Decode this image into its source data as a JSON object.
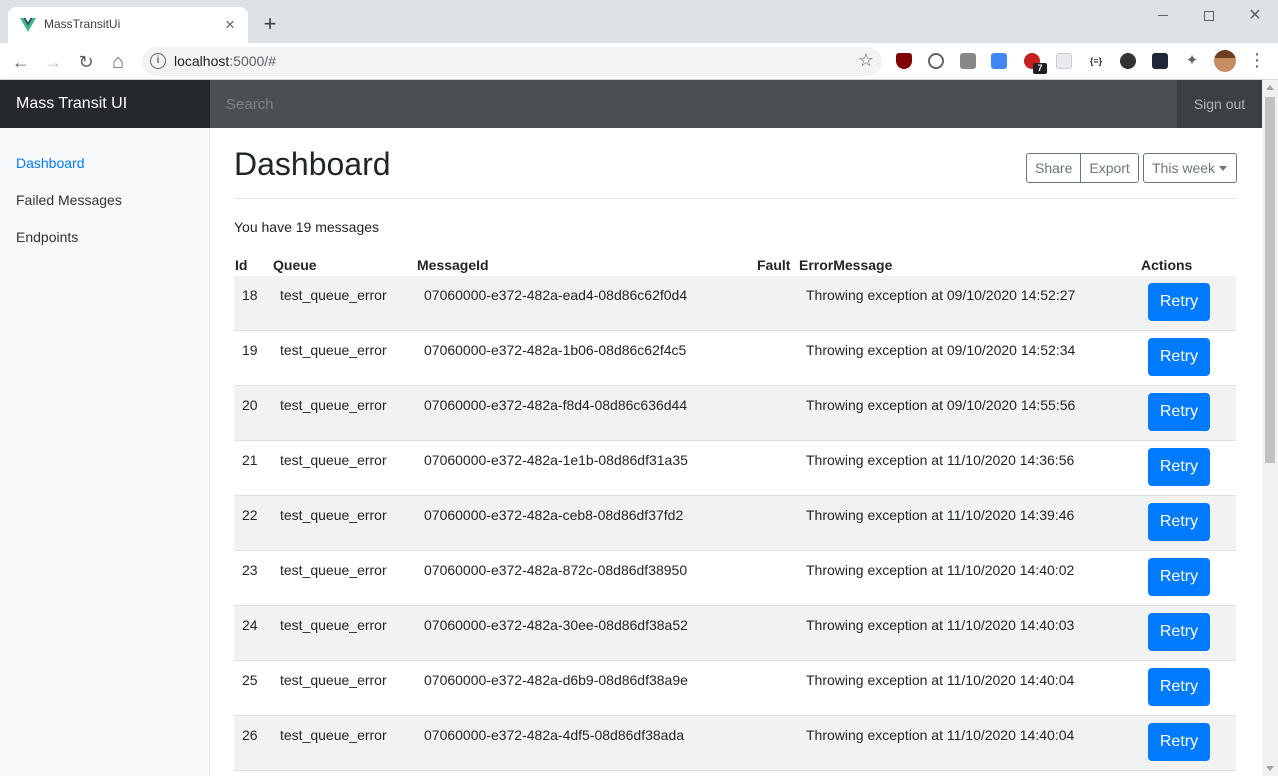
{
  "browser": {
    "tab_title": "MassTransitUi",
    "tab_close": "×",
    "new_tab": "+",
    "url_host": "localhost",
    "url_rest": ":5000/#",
    "info_symbol": "i",
    "star_symbol": "☆",
    "ext_badge": "7",
    "back": "←",
    "forward": "→",
    "reload": "↻",
    "home": "⌂",
    "menu": "⋮",
    "close_symbol": "✕"
  },
  "navbar": {
    "brand": "Mass Transit UI",
    "search_placeholder": "Search",
    "sign_out": "Sign out"
  },
  "sidebar": {
    "items": [
      {
        "label": "Dashboard",
        "active": true
      },
      {
        "label": "Failed Messages",
        "active": false
      },
      {
        "label": "Endpoints",
        "active": false
      }
    ]
  },
  "main": {
    "title": "Dashboard",
    "share": "Share",
    "export": "Export",
    "period": "This week",
    "message_count_text": "You have 19 messages"
  },
  "table": {
    "headers": [
      "Id",
      "Queue",
      "MessageId",
      "Fault",
      "ErrorMessage",
      "Actions"
    ],
    "retry_label": "Retry",
    "rows": [
      {
        "id": "18",
        "queue": "test_queue_error",
        "message_id": "07060000-e372-482a-ead4-08d86c62f0d4",
        "fault": "",
        "error": "Throwing exception at 09/10/2020 14:52:27"
      },
      {
        "id": "19",
        "queue": "test_queue_error",
        "message_id": "07060000-e372-482a-1b06-08d86c62f4c5",
        "fault": "",
        "error": "Throwing exception at 09/10/2020 14:52:34"
      },
      {
        "id": "20",
        "queue": "test_queue_error",
        "message_id": "07060000-e372-482a-f8d4-08d86c636d44",
        "fault": "",
        "error": "Throwing exception at 09/10/2020 14:55:56"
      },
      {
        "id": "21",
        "queue": "test_queue_error",
        "message_id": "07060000-e372-482a-1e1b-08d86df31a35",
        "fault": "",
        "error": "Throwing exception at 11/10/2020 14:36:56"
      },
      {
        "id": "22",
        "queue": "test_queue_error",
        "message_id": "07060000-e372-482a-ceb8-08d86df37fd2",
        "fault": "",
        "error": "Throwing exception at 11/10/2020 14:39:46"
      },
      {
        "id": "23",
        "queue": "test_queue_error",
        "message_id": "07060000-e372-482a-872c-08d86df38950",
        "fault": "",
        "error": "Throwing exception at 11/10/2020 14:40:02"
      },
      {
        "id": "24",
        "queue": "test_queue_error",
        "message_id": "07060000-e372-482a-30ee-08d86df38a52",
        "fault": "",
        "error": "Throwing exception at 11/10/2020 14:40:03"
      },
      {
        "id": "25",
        "queue": "test_queue_error",
        "message_id": "07060000-e372-482a-d6b9-08d86df38a9e",
        "fault": "",
        "error": "Throwing exception at 11/10/2020 14:40:04"
      },
      {
        "id": "26",
        "queue": "test_queue_error",
        "message_id": "07060000-e372-482a-4df5-08d86df38ada",
        "fault": "",
        "error": "Throwing exception at 11/10/2020 14:40:04"
      }
    ]
  },
  "colors": {
    "primary": "#007bff",
    "navbar": "#343a40",
    "brand_bg": "#25292d"
  }
}
